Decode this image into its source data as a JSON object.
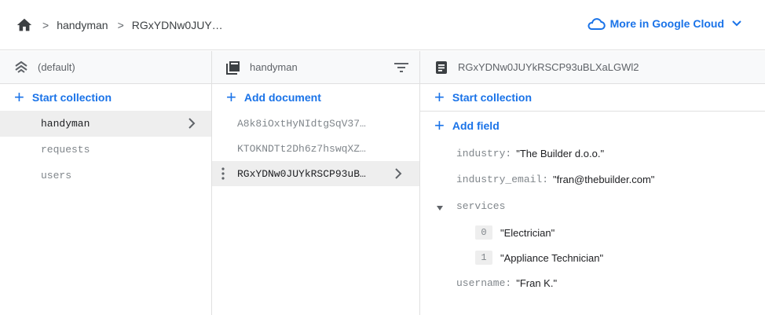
{
  "breadcrumb": {
    "items": [
      "handyman",
      "RGxYDNw0JUY…"
    ],
    "home_icon": "home-icon"
  },
  "header_action": {
    "label": "More in Google Cloud",
    "icon": "cloud-icon",
    "accent": "#1a73e8"
  },
  "col1": {
    "title": "(default)",
    "icon": "database-icon",
    "add_label": "Start collection",
    "items": [
      "handyman",
      "requests",
      "users"
    ],
    "selected": 0
  },
  "col2": {
    "title": "handyman",
    "icon": "collection-icon",
    "add_label": "Add document",
    "docs": [
      "A8k8iOxtHyNIdtgSqV37…",
      "KTOKNDTt2Dh6z7hswqXZ…",
      "RGxYDNw0JUYkRSCP93uB…"
    ],
    "selected": 2
  },
  "col3": {
    "title": "RGxYDNw0JUYkRSCP93uBLXaLGWl2",
    "icon": "document-icon",
    "start_collection_label": "Start collection",
    "add_field_label": "Add field",
    "fields": {
      "industry_key": "industry:",
      "industry_val": "\"The Builder d.o.o.\"",
      "email_key": "industry_email:",
      "email_val": "\"fran@thebuilder.com\"",
      "services_key": "services",
      "services": [
        {
          "index": "0",
          "value": "\"Electrician\""
        },
        {
          "index": "1",
          "value": "\"Appliance Technician\""
        }
      ],
      "username_key": "username:",
      "username_val": "\"Fran K.\""
    }
  }
}
